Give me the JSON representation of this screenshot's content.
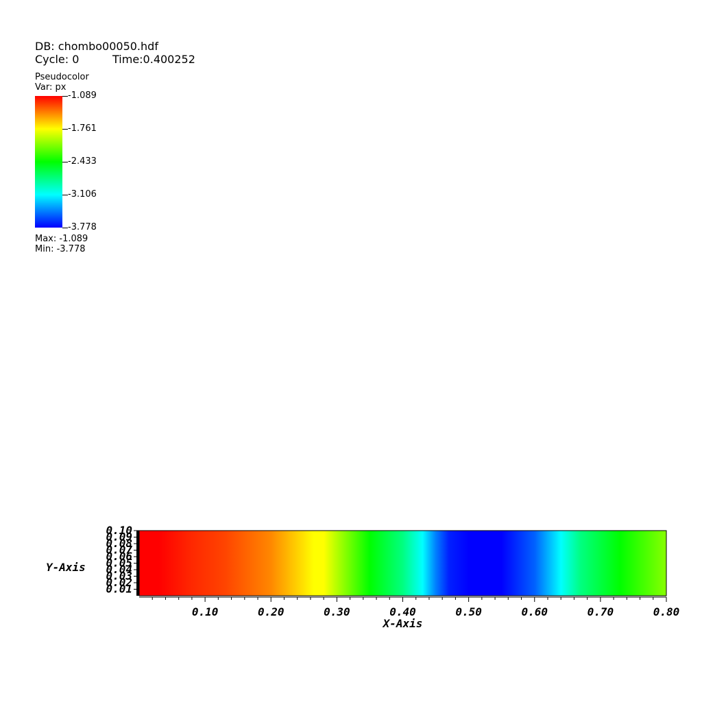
{
  "header": {
    "db": "DB: chombo00050.hdf",
    "cycle": "Cycle: 0",
    "time": "Time:0.400252"
  },
  "legend": {
    "plot_type": "Pseudocolor",
    "var": "Var: px",
    "ticks": [
      "-1.089",
      "-1.761",
      "-2.433",
      "-3.106",
      "-3.778"
    ],
    "max": "Max: -1.089",
    "min": "Min: -3.778",
    "colors": [
      "#ff0000",
      "#ffff00",
      "#00ff00",
      "#00ffff",
      "#0000ff"
    ]
  },
  "chart_data": {
    "type": "heatmap",
    "title": "",
    "xlabel": "X-Axis",
    "ylabel": "Y-Axis",
    "xlim": [
      0,
      0.8
    ],
    "ylim": [
      0,
      0.1
    ],
    "x_ticks": [
      "0.10",
      "0.20",
      "0.30",
      "0.40",
      "0.50",
      "0.60",
      "0.70",
      "0.80"
    ],
    "y_ticks": [
      "0.01",
      "0.02",
      "0.03",
      "0.04",
      "0.05",
      "0.06",
      "0.07",
      "0.08",
      "0.09",
      "0.10"
    ],
    "colormap_range": [
      -3.778,
      -1.089
    ],
    "color_profile_x": [
      0.0,
      0.03,
      0.08,
      0.13,
      0.2,
      0.265,
      0.28,
      0.3,
      0.35,
      0.4,
      0.43,
      0.45,
      0.47,
      0.5,
      0.55,
      0.6,
      0.64,
      0.67,
      0.73,
      0.8
    ],
    "color_profile_color": [
      "#ff0000",
      "#ff0000",
      "#ff2800",
      "#ff4400",
      "#ff8800",
      "#ffff00",
      "#ffff00",
      "#b4ff00",
      "#00ff00",
      "#00ff80",
      "#00ffff",
      "#0080ff",
      "#0020ff",
      "#0000ff",
      "#0000ff",
      "#0060ff",
      "#00ffff",
      "#00ff80",
      "#00ff00",
      "#88ff00"
    ]
  }
}
